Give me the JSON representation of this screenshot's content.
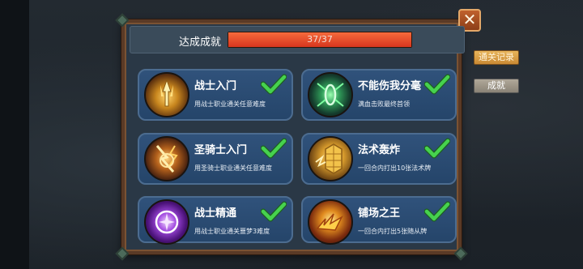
{
  "header": {
    "label": "达成成就",
    "progress_text": "37/37",
    "progress": 1.0
  },
  "side_tabs": {
    "clear_records": "通关记录",
    "achievements": "成就"
  },
  "close_label": "✕",
  "achievements": [
    {
      "title": "战士入门",
      "desc": "用战士职业通关任意难度",
      "icon": "golden-spear-icon",
      "done": true
    },
    {
      "title": "不能伤我分毫",
      "desc": "满血击败最终首领",
      "icon": "green-rune-icon",
      "done": true
    },
    {
      "title": "圣骑士入门",
      "desc": "用圣骑士职业通关任意难度",
      "icon": "lightning-shield-icon",
      "done": true
    },
    {
      "title": "法术轰炸",
      "desc": "一回合内打出10张法术牌",
      "icon": "golden-scales-icon",
      "done": true
    },
    {
      "title": "战士精通",
      "desc": "用战士职业通关噩梦3难度",
      "icon": "purple-orb-icon",
      "done": true
    },
    {
      "title": "铺场之王",
      "desc": "一回合内打出5张随从牌",
      "icon": "fire-burst-icon",
      "done": true
    }
  ],
  "colors": {
    "frame_border": "#5a3a26",
    "card_bg": "#30527b",
    "progress_fill": "#e34a2a",
    "check_green": "#3fcf4a"
  }
}
